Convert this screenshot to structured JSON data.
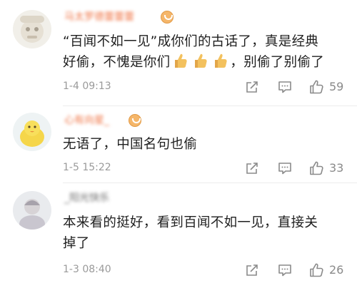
{
  "comments": [
    {
      "username": "马太罗德蕾蕾蕾",
      "text_line1": "“百闻不如一见”成你们的古话了，真是经典",
      "text_line2_a": "好偷，不愧是你们",
      "text_line2_b": "，别偷了别偷了",
      "thumb_count": 3,
      "time": "1-4 09:13",
      "likes": "59",
      "has_badge": true
    },
    {
      "username": "心有向星_",
      "text_line1": "无语了，中国名句也偷",
      "time": "1-5 15:22",
      "likes": "33",
      "has_badge": true
    },
    {
      "username": "_阳光快乐",
      "text_line1": "本来看的挺好，看到百闻不如一见，直接关",
      "text_line2": "掉了",
      "time": "1-3 08:40",
      "likes": "26",
      "has_badge": false
    }
  ],
  "icons": {
    "share": "share-icon",
    "comment": "comment-icon",
    "like": "thumbs-up-icon",
    "emoji": "thumbs-up-emoji"
  },
  "colors": {
    "username": "#f0784a",
    "text": "#1f1f1f",
    "meta": "#9a9a9a",
    "divider": "#ececec"
  }
}
